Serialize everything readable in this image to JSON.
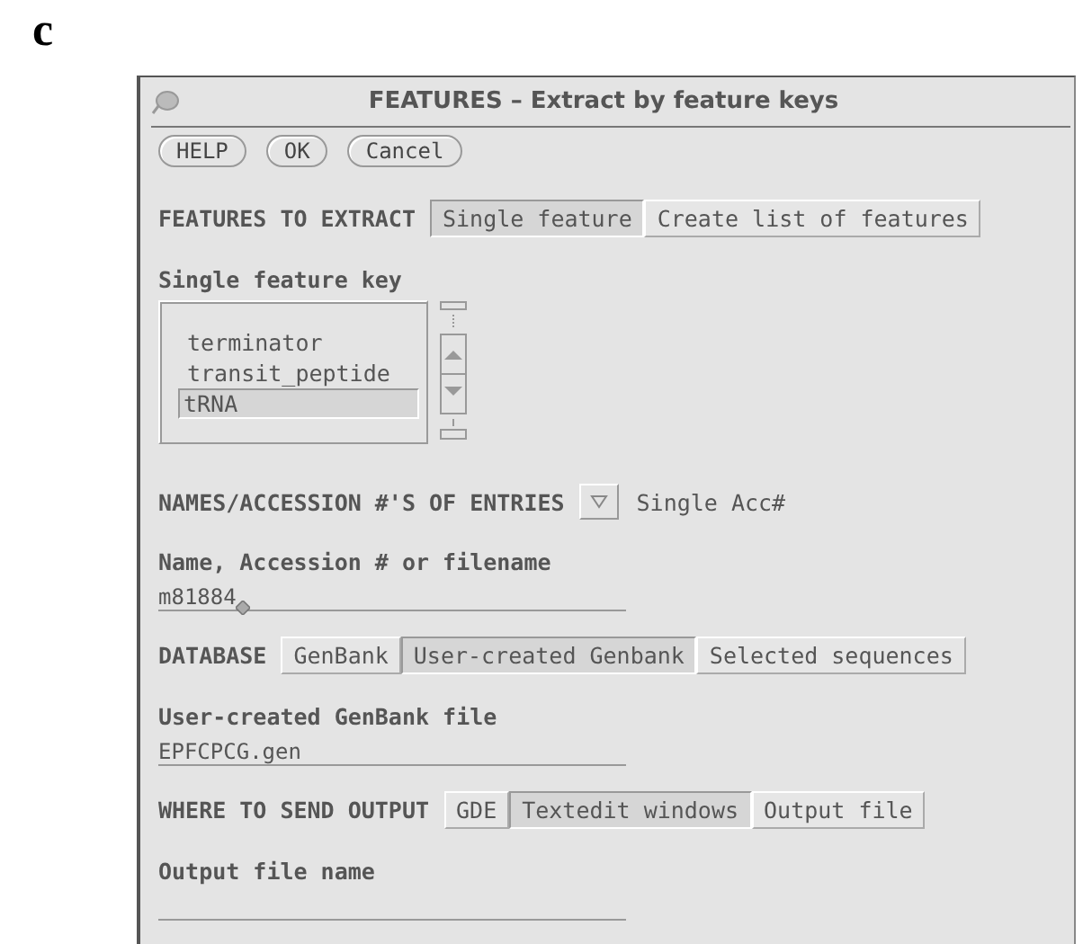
{
  "figure_label": "c",
  "window": {
    "title": "FEATURES – Extract by feature keys"
  },
  "buttons": [
    "HELP",
    "OK",
    "Cancel"
  ],
  "sections": [
    {
      "kind": "choice",
      "label": "FEATURES TO EXTRACT",
      "options": [
        {
          "label": "Single feature",
          "selected": true
        },
        {
          "label": "Create list of features",
          "selected": false
        }
      ]
    },
    {
      "kind": "list",
      "label": "Single feature key",
      "items": [
        {
          "label": "terminator",
          "selected": false
        },
        {
          "label": "transit_peptide",
          "selected": false
        },
        {
          "label": "tRNA",
          "selected": true
        }
      ]
    },
    {
      "kind": "menu",
      "label": "NAMES/ACCESSION #'S OF ENTRIES",
      "value": "Single Acc#"
    },
    {
      "kind": "field",
      "label": "Name, Accession # or filename",
      "value": "m81884",
      "caret": true
    },
    {
      "kind": "choice",
      "label": "DATABASE",
      "options": [
        {
          "label": "GenBank",
          "selected": false
        },
        {
          "label": "User-created Genbank",
          "selected": true
        },
        {
          "label": "Selected sequences",
          "selected": false
        }
      ]
    },
    {
      "kind": "field",
      "label": "User-created GenBank file",
      "value": "EPFCPCG.gen",
      "caret": false
    },
    {
      "kind": "choice",
      "label": "WHERE TO SEND OUTPUT",
      "options": [
        {
          "label": "GDE",
          "selected": false
        },
        {
          "label": "Textedit windows",
          "selected": true
        },
        {
          "label": "Output file",
          "selected": false
        }
      ]
    },
    {
      "kind": "field",
      "label": "Output file name",
      "caret": false
    }
  ]
}
